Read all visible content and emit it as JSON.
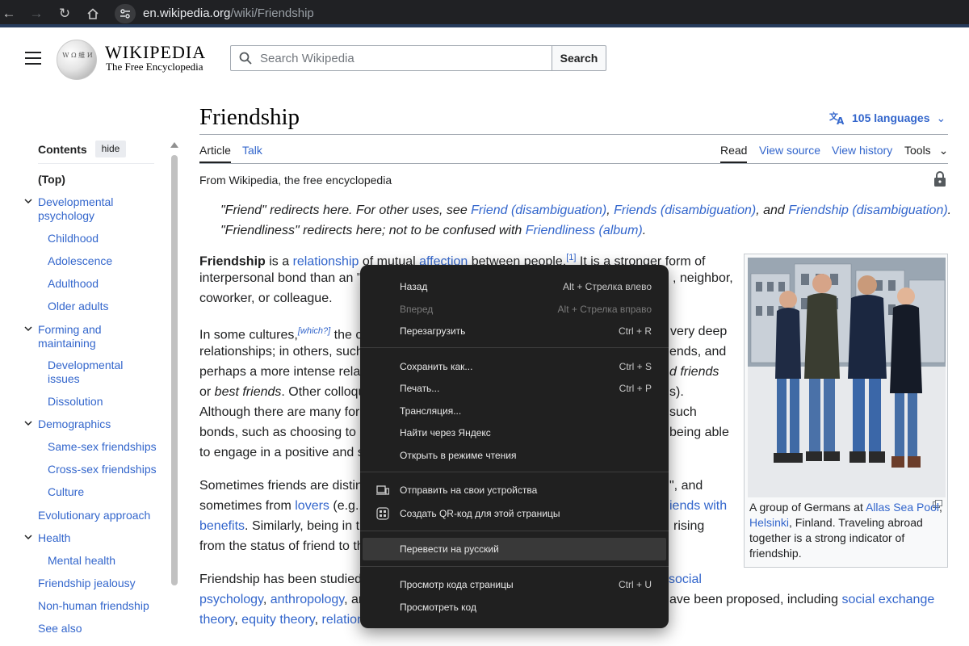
{
  "browser": {
    "url_domain": "en.wikipedia.org",
    "url_path": "/wiki/Friendship"
  },
  "wiki_header": {
    "wordmark": "WIKIPEDIA",
    "tagline": "The Free Encyclopedia",
    "search_placeholder": "Search Wikipedia",
    "search_button": "Search"
  },
  "toc": {
    "title": "Contents",
    "hide": "hide",
    "items": [
      {
        "label": "(Top)"
      },
      {
        "label": "Developmental psychology"
      },
      {
        "label": "Childhood"
      },
      {
        "label": "Adolescence"
      },
      {
        "label": "Adulthood"
      },
      {
        "label": "Older adults"
      },
      {
        "label": "Forming and maintaining"
      },
      {
        "label": "Developmental issues"
      },
      {
        "label": "Dissolution"
      },
      {
        "label": "Demographics"
      },
      {
        "label": "Same-sex friendships"
      },
      {
        "label": "Cross-sex friendships"
      },
      {
        "label": "Culture"
      },
      {
        "label": "Evolutionary approach"
      },
      {
        "label": "Health"
      },
      {
        "label": "Mental health"
      },
      {
        "label": "Friendship jealousy"
      },
      {
        "label": "Non-human friendship"
      },
      {
        "label": "See also"
      }
    ]
  },
  "article": {
    "title": "Friendship",
    "languages": "105 languages",
    "tabs": {
      "article": "Article",
      "talk": "Talk",
      "read": "Read",
      "view_source": "View source",
      "view_history": "View history",
      "tools": "Tools"
    },
    "from": "From Wikipedia, the free encyclopedia",
    "hatnote1": {
      "a": "\"Friend\" redirects here. For other uses, see ",
      "l1": "Friend (disambiguation)",
      "c1": ", ",
      "l2": "Friends (disambiguation)",
      "c2": ", and ",
      "l3": "Friendship (disambiguation)",
      "end": "."
    },
    "hatnote2": {
      "a": "\"Friendliness\" redirects here; not to be confused with ",
      "l1": "Friendliness (album)",
      "end": "."
    },
    "p1": {
      "l1a": "Friendship",
      "l1b": " is a ",
      "l1c": "relationship",
      "l1d": " of mutual ",
      "l1e": "affection",
      "l1f": " between people.",
      "l1g": "[1]",
      "l1h": " It is a stronger form of",
      "l2a": "interpersonal bond than an \"a",
      "l2b": ", neighbor,",
      "l3": "coworker, or colleague."
    },
    "p2": {
      "l1a": "In some cultures,",
      "l1b": "[which?]",
      "l1c": " the c",
      "l1d": "very deep",
      "l2a": "relationships; in others, such",
      "l2b": "ends, and",
      "l3a": "perhaps a more intense relat",
      "l3b": "d friends",
      "l4a": "or ",
      "l4b": "best friends",
      "l4c": ". Other colloqu",
      "l4d": "s).",
      "l5a": "Although there are many forr",
      "l5b": "such",
      "l6a": "bonds, such as choosing to b",
      "l6b": "being able",
      "l7": "to engage in a positive and s"
    },
    "p3": {
      "l1a": "Sometimes friends are disting",
      "l1b": "\", and",
      "l2a": "sometimes from ",
      "l2b": "lovers",
      "l2c": " (e.g., ",
      "l2d": "iends with",
      "l3a": "benefits",
      "l3b": ". Similarly, being in th",
      "l3c": "rising",
      "l4": "from the status of friend to th"
    },
    "p4": {
      "l1a": "Friendship has been studied",
      "l1b": "social",
      "l2a": "psychology",
      "l2b": ", ",
      "l2c": "anthropology",
      "l2d": ", an",
      "l2e": "ave been proposed, including ",
      "l2f": "social exchange",
      "l3a": "theory",
      "l3b": ", ",
      "l3c": "equity theory",
      "l3d": ", ",
      "l3e": "relation"
    },
    "caption": {
      "a": "A group of Germans at ",
      "l1": "Allas Sea Pool",
      "b": ", ",
      "l2": "Helsinki",
      "c": ", Finland. Traveling abroad together is a strong indicator of friendship."
    }
  },
  "context_menu": {
    "items": [
      {
        "label": "Назад",
        "shortcut": "Alt + Стрелка влево"
      },
      {
        "label": "Вперед",
        "shortcut": "Alt + Стрелка вправо"
      },
      {
        "label": "Перезагрузить",
        "shortcut": "Ctrl + R"
      },
      {
        "label": "Сохранить как...",
        "shortcut": "Ctrl + S"
      },
      {
        "label": "Печать...",
        "shortcut": "Ctrl + P"
      },
      {
        "label": "Трансляция..."
      },
      {
        "label": "Найти через Яндекс"
      },
      {
        "label": "Открыть в режиме чтения"
      },
      {
        "label": "Отправить на свои устройства"
      },
      {
        "label": "Создать QR-код для этой страницы"
      },
      {
        "label": "Перевести на русский"
      },
      {
        "label": "Просмотр кода страницы",
        "shortcut": "Ctrl + U"
      },
      {
        "label": "Просмотреть код"
      }
    ]
  }
}
